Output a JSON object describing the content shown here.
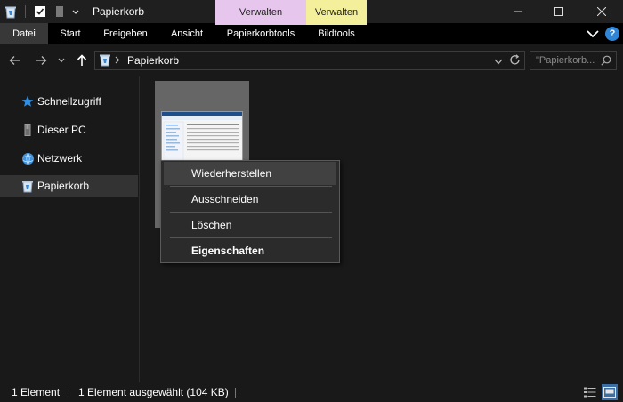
{
  "window": {
    "title": "Papierkorb",
    "context_tab_manage_1": "Verwalten",
    "context_tab_manage_2": "Verwalten"
  },
  "ribbon": {
    "tabs": [
      {
        "label": "Datei",
        "active": true
      },
      {
        "label": "Start"
      },
      {
        "label": "Freigeben"
      },
      {
        "label": "Ansicht"
      },
      {
        "label": "Papierkorbtools"
      },
      {
        "label": "Bildtools"
      }
    ]
  },
  "address": {
    "path": "Papierkorb",
    "search_placeholder": "\"Papierkorb..."
  },
  "nav": {
    "items": [
      {
        "label": "Schnellzugriff",
        "icon": "star-icon"
      },
      {
        "label": "Dieser PC",
        "icon": "computer-icon"
      },
      {
        "label": "Netzwerk",
        "icon": "network-icon"
      },
      {
        "label": "Papierkorb",
        "icon": "recycle-bin-icon",
        "selected": true
      }
    ]
  },
  "context_menu": {
    "items": [
      {
        "label": "Wiederherstellen"
      },
      {
        "label": "Ausschneiden"
      },
      {
        "label": "Löschen"
      },
      {
        "label": "Eigenschaften"
      }
    ]
  },
  "status": {
    "count": "1 Element",
    "selection": "1 Element ausgewählt (104 KB)"
  },
  "colors": {
    "context_pink": "#e6c6ec",
    "context_yellow": "#f3ef9a",
    "accent_blue": "#2f86d8"
  }
}
